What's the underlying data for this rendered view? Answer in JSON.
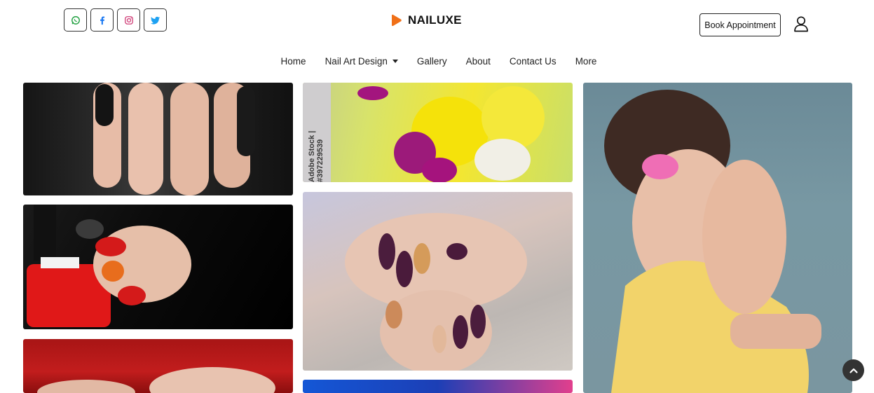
{
  "header": {
    "social": [
      {
        "name": "whatsapp-icon"
      },
      {
        "name": "facebook-icon"
      },
      {
        "name": "instagram-icon"
      },
      {
        "name": "twitter-icon"
      }
    ],
    "brand": {
      "name": "NAILUXE",
      "logo_color": "#f07018"
    },
    "book_label": "Book Appointment",
    "user_icon": "user-icon"
  },
  "nav": {
    "items": [
      "Home",
      "Nail Art Design",
      "Gallery",
      "About",
      "Contact Us",
      "More"
    ]
  },
  "gallery": {
    "watermark": "Adobe Stock | #397229539"
  },
  "colors": {
    "whatsapp": "#25a244",
    "facebook": "#1877f2",
    "instagram": "#d1427a",
    "twitter": "#1da1f2",
    "accent": "#f07018"
  }
}
